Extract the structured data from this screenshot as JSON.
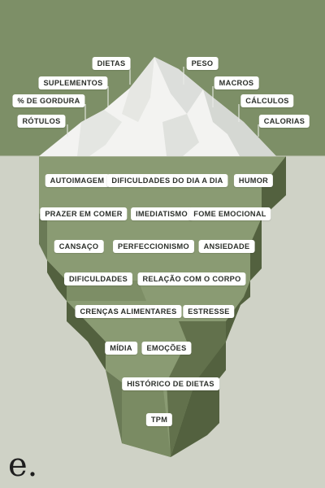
{
  "colors": {
    "sky": "#7d8f67",
    "sea": "#cfd2c6",
    "snow": "#f3f3f1",
    "snow_shadow": "#dcdedb",
    "ice_light": "#8a9b73",
    "ice_mid": "#73845f",
    "ice_dark": "#53613f",
    "label_bg": "#ffffff"
  },
  "above_water": {
    "labels": [
      "DIETAS",
      "PESO",
      "SUPLEMENTOS",
      "MACROS",
      "% DE GORDURA",
      "CÁLCULOS",
      "RÓTULOS",
      "CALORIAS"
    ]
  },
  "below_water": {
    "labels": [
      "AUTOIMAGEM",
      "DIFICULDADES DO DIA A DIA",
      "HUMOR",
      "PRAZER EM COMER",
      "IMEDIATISMO",
      "FOME EMOCIONAL",
      "CANSAÇO",
      "PERFECCIONISMO",
      "ANSIEDADE",
      "DIFICULDADES",
      "RELAÇÃO COM O CORPO",
      "CRENÇAS ALIMENTARES",
      "ESTRESSE",
      "MÍDIA",
      "EMOÇÕES",
      "HISTÓRICO DE DIETAS",
      "TPM"
    ]
  },
  "brand": {
    "logo_text": "e."
  }
}
